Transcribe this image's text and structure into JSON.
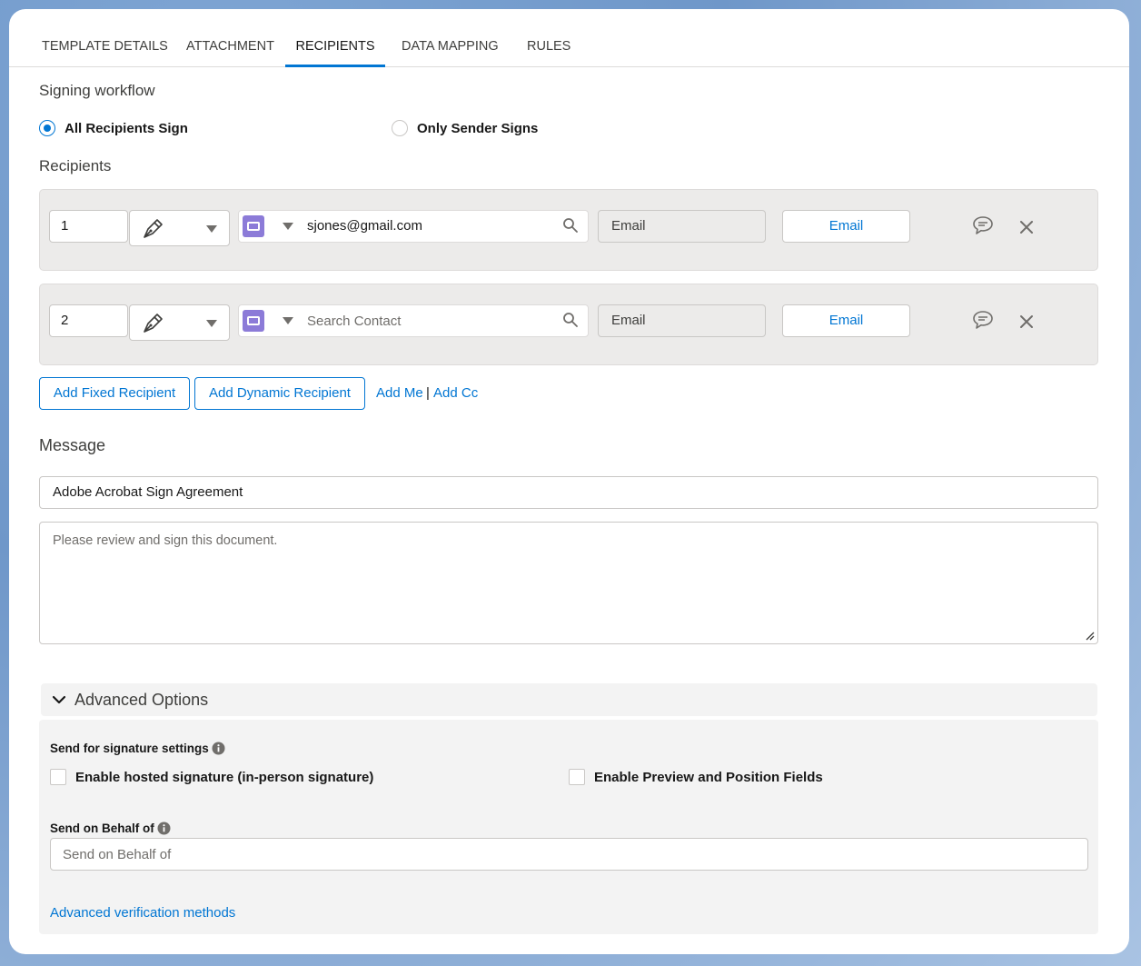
{
  "tabs": [
    {
      "label": "TEMPLATE DETAILS"
    },
    {
      "label": "ATTACHMENT"
    },
    {
      "label": "RECIPIENTS"
    },
    {
      "label": "DATA MAPPING"
    },
    {
      "label": "RULES"
    }
  ],
  "active_tab": "RECIPIENTS",
  "signing_workflow": {
    "label": "Signing workflow",
    "options": [
      {
        "label": "All Recipients Sign",
        "checked": true
      },
      {
        "label": "Only Sender Signs",
        "checked": false
      }
    ]
  },
  "recipients": {
    "label": "Recipients",
    "rows": [
      {
        "order": "1",
        "role_icon": "pen-icon",
        "contact_value": "sjones@gmail.com",
        "contact_placeholder": "",
        "method": "Email",
        "action_label": "Email"
      },
      {
        "order": "2",
        "role_icon": "pen-icon",
        "contact_value": "",
        "contact_placeholder": "Search Contact",
        "method": "Email",
        "action_label": "Email"
      }
    ],
    "add_fixed_label": "Add Fixed Recipient",
    "add_dynamic_label": "Add Dynamic Recipient",
    "add_me_label": "Add Me",
    "separator": "|",
    "add_cc_label": "Add Cc"
  },
  "message": {
    "label": "Message",
    "subject": "Adobe Acrobat Sign Agreement",
    "body_placeholder": "Please review and sign this document."
  },
  "advanced": {
    "title": "Advanced Options",
    "signature_settings_label": "Send for signature settings",
    "hosted_signature_label": "Enable hosted signature (in-person signature)",
    "preview_position_label": "Enable Preview and Position Fields",
    "behalf_label": "Send on Behalf of",
    "behalf_placeholder": "Send on Behalf of",
    "verification_link": "Advanced verification methods"
  },
  "colors": {
    "accent": "#0176d3",
    "contact_badge": "#8c7bd8",
    "row_bg": "#ecebea"
  }
}
